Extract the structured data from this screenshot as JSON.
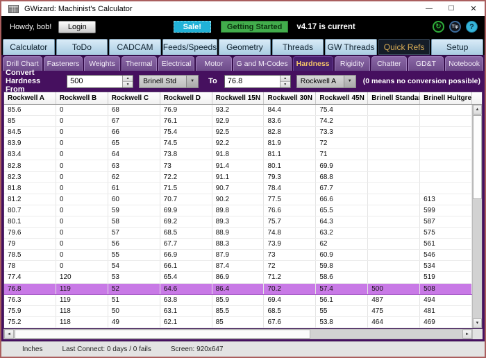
{
  "window": {
    "title": "GWizard: Machinist's Calculator"
  },
  "topbar": {
    "greeting": "Howdy, bob!",
    "login_label": "Login",
    "sale_label": "Sale!",
    "getting_started_label": "Getting Started",
    "version_text": "v4.17 is current",
    "tip_label": "Tip",
    "help_label": "?",
    "refresh_glyph": "↻"
  },
  "main_tabs": {
    "items": [
      "Calculator",
      "ToDo",
      "CADCAM",
      "Feeds/Speeds",
      "Geometry",
      "Threads",
      "GW Threads",
      "Quick Refs",
      "Setup"
    ],
    "selected": "Quick Refs"
  },
  "sub_tabs": {
    "items": [
      "Drill Chart",
      "Fasteners",
      "Weights",
      "Thermal",
      "Electrical",
      "Motor",
      "G and M-Codes",
      "Hardness",
      "Rigidity",
      "Chatter",
      "GD&T",
      "Notebook"
    ],
    "selected": "Hardness"
  },
  "converter": {
    "from_label": "Convert Hardness From",
    "from_value": "500",
    "from_unit": "Brinell Std",
    "to_label": "To",
    "to_value": "76.8",
    "to_unit": "Rockwell A",
    "hint": "(0 means no conversion possible)"
  },
  "table": {
    "columns": [
      "Rockwell A",
      "Rockwell B",
      "Rockwell C",
      "Rockwell D",
      "Rockwell 15N",
      "Rockwell 30N",
      "Rockwell 45N",
      "Brinell Standard",
      "Brinell Hultgren"
    ],
    "highlighted_row_index": 16,
    "rows": [
      [
        "85.6",
        "0",
        "68",
        "76.9",
        "93.2",
        "84.4",
        "75.4",
        "",
        ""
      ],
      [
        "85",
        "0",
        "67",
        "76.1",
        "92.9",
        "83.6",
        "74.2",
        "",
        ""
      ],
      [
        "84.5",
        "0",
        "66",
        "75.4",
        "92.5",
        "82.8",
        "73.3",
        "",
        ""
      ],
      [
        "83.9",
        "0",
        "65",
        "74.5",
        "92.2",
        "81.9",
        "72",
        "",
        ""
      ],
      [
        "83.4",
        "0",
        "64",
        "73.8",
        "91.8",
        "81.1",
        "71",
        "",
        ""
      ],
      [
        "82.8",
        "0",
        "63",
        "73",
        "91.4",
        "80.1",
        "69.9",
        "",
        ""
      ],
      [
        "82.3",
        "0",
        "62",
        "72.2",
        "91.1",
        "79.3",
        "68.8",
        "",
        ""
      ],
      [
        "81.8",
        "0",
        "61",
        "71.5",
        "90.7",
        "78.4",
        "67.7",
        "",
        ""
      ],
      [
        "81.2",
        "0",
        "60",
        "70.7",
        "90.2",
        "77.5",
        "66.6",
        "",
        "613"
      ],
      [
        "80.7",
        "0",
        "59",
        "69.9",
        "89.8",
        "76.6",
        "65.5",
        "",
        "599"
      ],
      [
        "80.1",
        "0",
        "58",
        "69.2",
        "89.3",
        "75.7",
        "64.3",
        "",
        "587"
      ],
      [
        "79.6",
        "0",
        "57",
        "68.5",
        "88.9",
        "74.8",
        "63.2",
        "",
        "575"
      ],
      [
        "79",
        "0",
        "56",
        "67.7",
        "88.3",
        "73.9",
        "62",
        "",
        "561"
      ],
      [
        "78.5",
        "0",
        "55",
        "66.9",
        "87.9",
        "73",
        "60.9",
        "",
        "546"
      ],
      [
        "78",
        "0",
        "54",
        "66.1",
        "87.4",
        "72",
        "59.8",
        "",
        "534"
      ],
      [
        "77.4",
        "120",
        "53",
        "65.4",
        "86.9",
        "71.2",
        "58.6",
        "",
        "519"
      ],
      [
        "76.8",
        "119",
        "52",
        "64.6",
        "86.4",
        "70.2",
        "57.4",
        "500",
        "508"
      ],
      [
        "76.3",
        "119",
        "51",
        "63.8",
        "85.9",
        "69.4",
        "56.1",
        "487",
        "494"
      ],
      [
        "75.9",
        "118",
        "50",
        "63.1",
        "85.5",
        "68.5",
        "55",
        "475",
        "481"
      ],
      [
        "75.2",
        "118",
        "49",
        "62.1",
        "85",
        "67.6",
        "53.8",
        "464",
        "469"
      ]
    ]
  },
  "statusbar": {
    "units": "Inches",
    "last_connect": "Last Connect: 0 days / 0 fails",
    "screen": "Screen: 920x647"
  },
  "colors": {
    "window_border": "#aa5e5e",
    "content_bg": "#46105f",
    "highlight_row": "#c879e6",
    "sale_bg": "#21b2d8",
    "getting_started_bg": "#42ad4c",
    "selected_tab_text": "#d9ad56",
    "selected_subtab_text": "#f3c368"
  }
}
